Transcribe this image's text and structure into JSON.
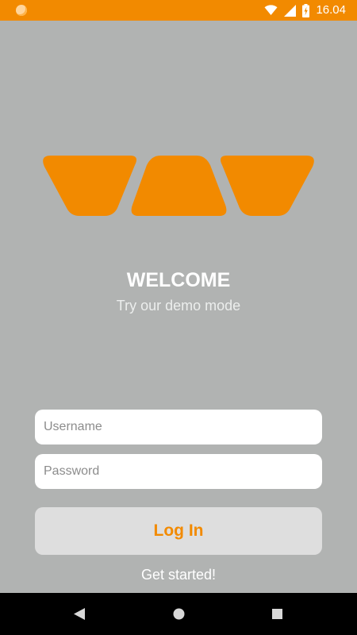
{
  "status_bar": {
    "time": "16.04",
    "icons": [
      "notification-dot-icon",
      "wifi-icon",
      "signal-icon",
      "battery-charging-icon"
    ],
    "background": "#f28a00"
  },
  "logo": {
    "name": "wedge-logo",
    "color": "#f28a00"
  },
  "welcome": {
    "title": "WELCOME",
    "subtitle": "Try our demo mode"
  },
  "form": {
    "username_placeholder": "Username",
    "password_placeholder": "Password",
    "username_value": "",
    "password_value": ""
  },
  "actions": {
    "login_label": "Log In",
    "get_started_label": "Get started!"
  },
  "nav_bar": {
    "icons": [
      "back-icon",
      "home-icon",
      "recents-icon"
    ]
  },
  "colors": {
    "accent": "#f28a00",
    "background": "#b1b3b2",
    "button": "#dedede"
  }
}
